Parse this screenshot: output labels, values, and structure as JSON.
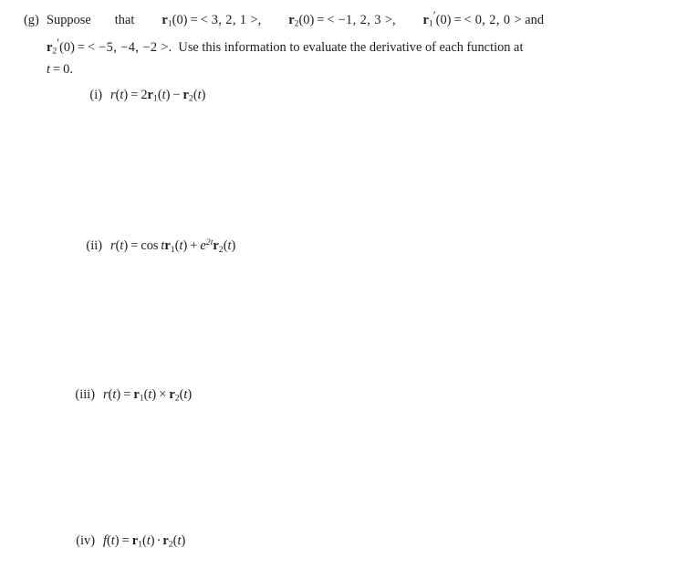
{
  "document": {
    "background_color": "#ffffff",
    "text_color": "#1c1c24"
  },
  "problem": {
    "label": "(g)",
    "line1": {
      "word_suppose": "Suppose",
      "word_that": "that",
      "given_r1_0": "r₁(0) =< 3, 2, 1 >,",
      "given_r2_0": "r₂(0) =< −1, 2, 3 >,",
      "given_r1_prime_0": "r₁′(0) =< 0, 2, 0 >",
      "trailing_and": "and"
    },
    "line2": {
      "given_r2_prime_0": "r₂′(0) =< −5, −4, −2 >.",
      "instruction": "Use this information to evaluate the derivative of each function at"
    },
    "line3": {
      "condition": "t = 0."
    },
    "full_text": "(g) Suppose that r₁(0) =< 3, 2, 1 >, r₂(0) =< −1, 2, 3 >, r₁′(0) =< 0, 2, 0 > and r₂′(0) =< −5, −4, −2 >. Use this information to evaluate the derivative of each function at t = 0.",
    "givens": [
      {
        "name": "r₁(0)",
        "value": "< 3, 2, 1 >",
        "components": [
          3,
          2,
          1
        ]
      },
      {
        "name": "r₂(0)",
        "value": "< −1, 2, 3 >",
        "components": [
          -1,
          2,
          3
        ]
      },
      {
        "name": "r₁′(0)",
        "value": "< 0, 2, 0 >",
        "components": [
          0,
          2,
          0
        ]
      },
      {
        "name": "r₂′(0)",
        "value": "< −5, −4, −2 >",
        "components": [
          -5,
          -4,
          -2
        ]
      }
    ],
    "evaluate_at": "t = 0"
  },
  "items": [
    {
      "label": "(i)",
      "function_name": "r",
      "expression_text": "r(t) = 2r₁(t) − r₂(t)",
      "coefficient": "2",
      "operator": "−",
      "operator_name": "minus"
    },
    {
      "label": "(ii)",
      "function_name": "r",
      "expression_text": "r(t) = cos t r₁(t) + e²ᵗ r₂(t)",
      "first_coefficient": "cos t",
      "second_coefficient": "e",
      "second_exponent": "2t",
      "operator": "+",
      "operator_name": "plus"
    },
    {
      "label": "(iii)",
      "function_name": "r",
      "expression_text": "r(t) = r₁(t) × r₂(t)",
      "operator": "×",
      "operator_name": "cross-product"
    },
    {
      "label": "(iv)",
      "function_name": "f",
      "expression_text": "f(t) = r₁(t) · r₂(t)",
      "operator": "·",
      "operator_name": "dot-product"
    }
  ],
  "answer_spaces": [
    {
      "for_item": "(i)",
      "content": ""
    },
    {
      "for_item": "(ii)",
      "content": ""
    },
    {
      "for_item": "(iii)",
      "content": ""
    },
    {
      "for_item": "(iv)",
      "content": ""
    }
  ]
}
